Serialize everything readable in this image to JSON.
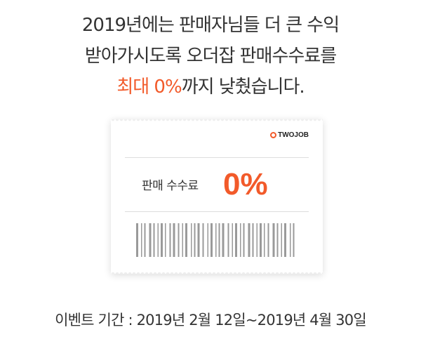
{
  "headline": {
    "line1": "2019년에는 판매자님들 더 큰 수익",
    "line2": "받아가시도록 오더잡 판매수수료를",
    "line3_accent": "최대 0%",
    "line3_rest": "까지 낮췄습니다."
  },
  "ticket": {
    "logo_text": "TWOJOB",
    "logo_icon": "orange-ring-icon",
    "fee_label": "판매 수수료",
    "fee_value": "0%"
  },
  "event_period": "이벤트 기간 : 2019년 2월 12일~2019년 4월 30일",
  "colors": {
    "accent": "#f25a2a",
    "text": "#333333",
    "barcode": "#9a9a9a"
  }
}
